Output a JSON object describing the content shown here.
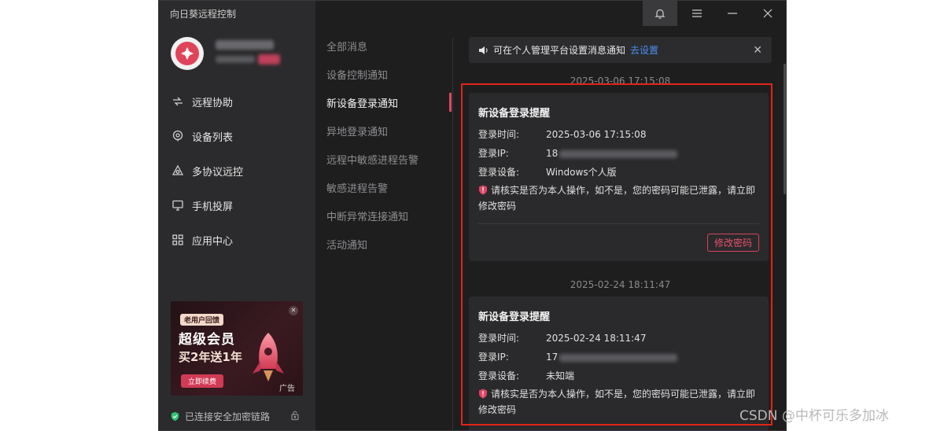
{
  "app": {
    "title": "向日葵远程控制"
  },
  "colors": {
    "accent": "#e04564",
    "link": "#4a90f2",
    "warn_icon": "#e04564",
    "secure_icon": "#34c471",
    "highlight": "#e2231a"
  },
  "sidebar": {
    "items": [
      {
        "label": "远程协助",
        "icon": "remote-assist-icon"
      },
      {
        "label": "设备列表",
        "icon": "device-list-icon"
      },
      {
        "label": "多协议远控",
        "icon": "multi-protocol-icon"
      },
      {
        "label": "手机投屏",
        "icon": "screen-cast-icon"
      },
      {
        "label": "应用中心",
        "icon": "app-center-icon"
      }
    ],
    "ad": {
      "tag": "老用户回馈",
      "headline": "超级会员",
      "subline": "买2年送1年",
      "button": "立即续费",
      "label": "广告"
    },
    "status": "已连接安全加密链路"
  },
  "categories": [
    {
      "label": "全部消息"
    },
    {
      "label": "设备控制通知"
    },
    {
      "label": "新设备登录通知"
    },
    {
      "label": "异地登录通知"
    },
    {
      "label": "远程中敏感进程告警"
    },
    {
      "label": "敏感进程告警"
    },
    {
      "label": "中断异常连接通知"
    },
    {
      "label": "活动通知"
    }
  ],
  "active_category": "新设备登录通知",
  "notice": {
    "text": "可在个人管理平台设置消息通知",
    "link": "去设置"
  },
  "messages": [
    {
      "timestamp": "2025-03-06 17:15:08",
      "title": "新设备登录提醒",
      "rows": [
        {
          "key": "登录时间:",
          "value": "2025-03-06 17:15:08"
        },
        {
          "key": "登录IP:",
          "value": "18"
        },
        {
          "key": "登录设备:",
          "value": "Windows个人版"
        }
      ],
      "warning": "请核实是否为本人操作，如不是，您的密码可能已泄露，请立即修改密码",
      "action": "修改密码"
    },
    {
      "timestamp": "2025-02-24 18:11:47",
      "title": "新设备登录提醒",
      "rows": [
        {
          "key": "登录时间:",
          "value": "2025-02-24 18:11:47"
        },
        {
          "key": "登录IP:",
          "value": "17"
        },
        {
          "key": "登录设备:",
          "value": "未知端"
        }
      ],
      "warning": "请核实是否为本人操作，如不是，您的密码可能已泄露，请立即修改密码"
    }
  ],
  "watermark": "CSDN @中杯可乐多加冰"
}
